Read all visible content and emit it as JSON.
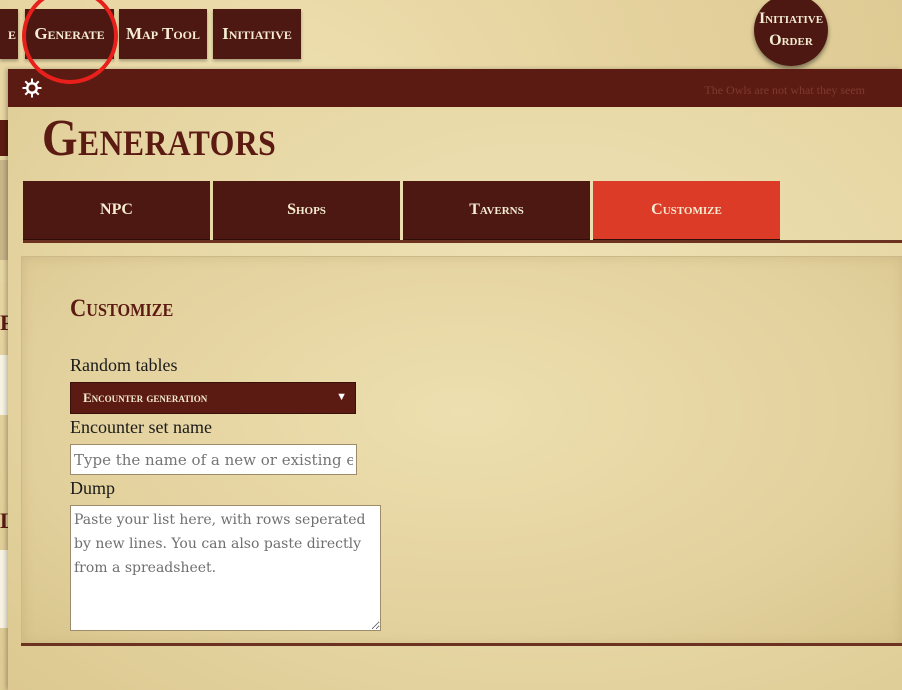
{
  "topnav": {
    "partial_label": "e",
    "generate": "Generate",
    "map_tool": "Map Tool",
    "initiative": "Initiative",
    "initiative_order_line1": "Initiative",
    "initiative_order_line2": "Order"
  },
  "panel": {
    "tagline": "The Owls are not what they seem",
    "title": "Generators",
    "tabs": [
      {
        "label": "NPC",
        "active": false
      },
      {
        "label": "Shops",
        "active": false
      },
      {
        "label": "Taverns",
        "active": false
      },
      {
        "label": "Customize",
        "active": true
      }
    ]
  },
  "customize": {
    "section_title": "Customize",
    "random_tables_label": "Random tables",
    "random_tables_selected": "Encounter generation",
    "encounter_set_label": "Encounter set name",
    "encounter_set_placeholder": "Type the name of a new or existing encounter set",
    "dump_label": "Dump",
    "dump_placeholder": "Paste your list here, with rows seperated by new lines. You can also paste directly from a spreadsheet."
  },
  "background_sidebar": {
    "snippet_1": "P",
    "snippet_2": "L"
  },
  "colors": {
    "brand_dark": "#5c1b12",
    "active_tab": "#dc3b28",
    "highlight_ring": "#e8201c",
    "parchment": "#e6d6a3"
  },
  "icons": {
    "settings": "gear-icon",
    "dropdown": "caret-down-icon"
  }
}
